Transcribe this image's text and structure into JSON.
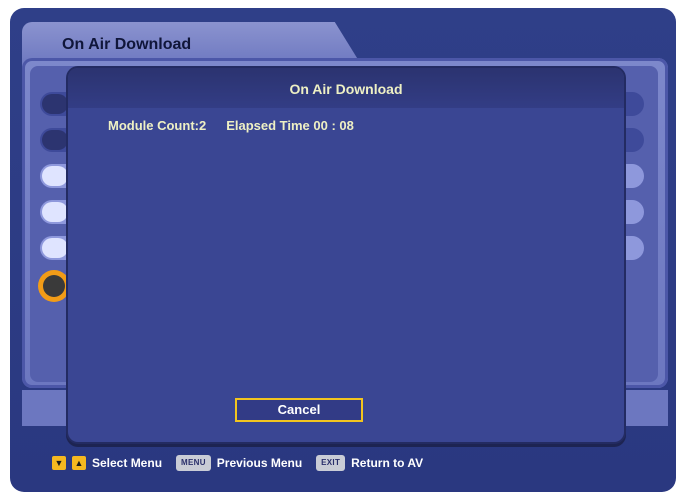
{
  "menu": {
    "title": "On Air Download"
  },
  "dialog": {
    "title": "On Air Download",
    "module_count": "Module Count:2",
    "elapsed_label": "Elapsed Time",
    "elapsed_value": "00 : 08",
    "cancel_label": "Cancel"
  },
  "footer": {
    "select_label": "Select Menu",
    "menu_key": "MENU",
    "previous_label": "Previous Menu",
    "exit_key": "EXIT",
    "return_label": "Return to AV"
  },
  "colors": {
    "accent": "#f3c51e",
    "selected": "#f29c17"
  },
  "icons": {
    "down": "arrow-down-icon",
    "up": "arrow-up-icon"
  }
}
